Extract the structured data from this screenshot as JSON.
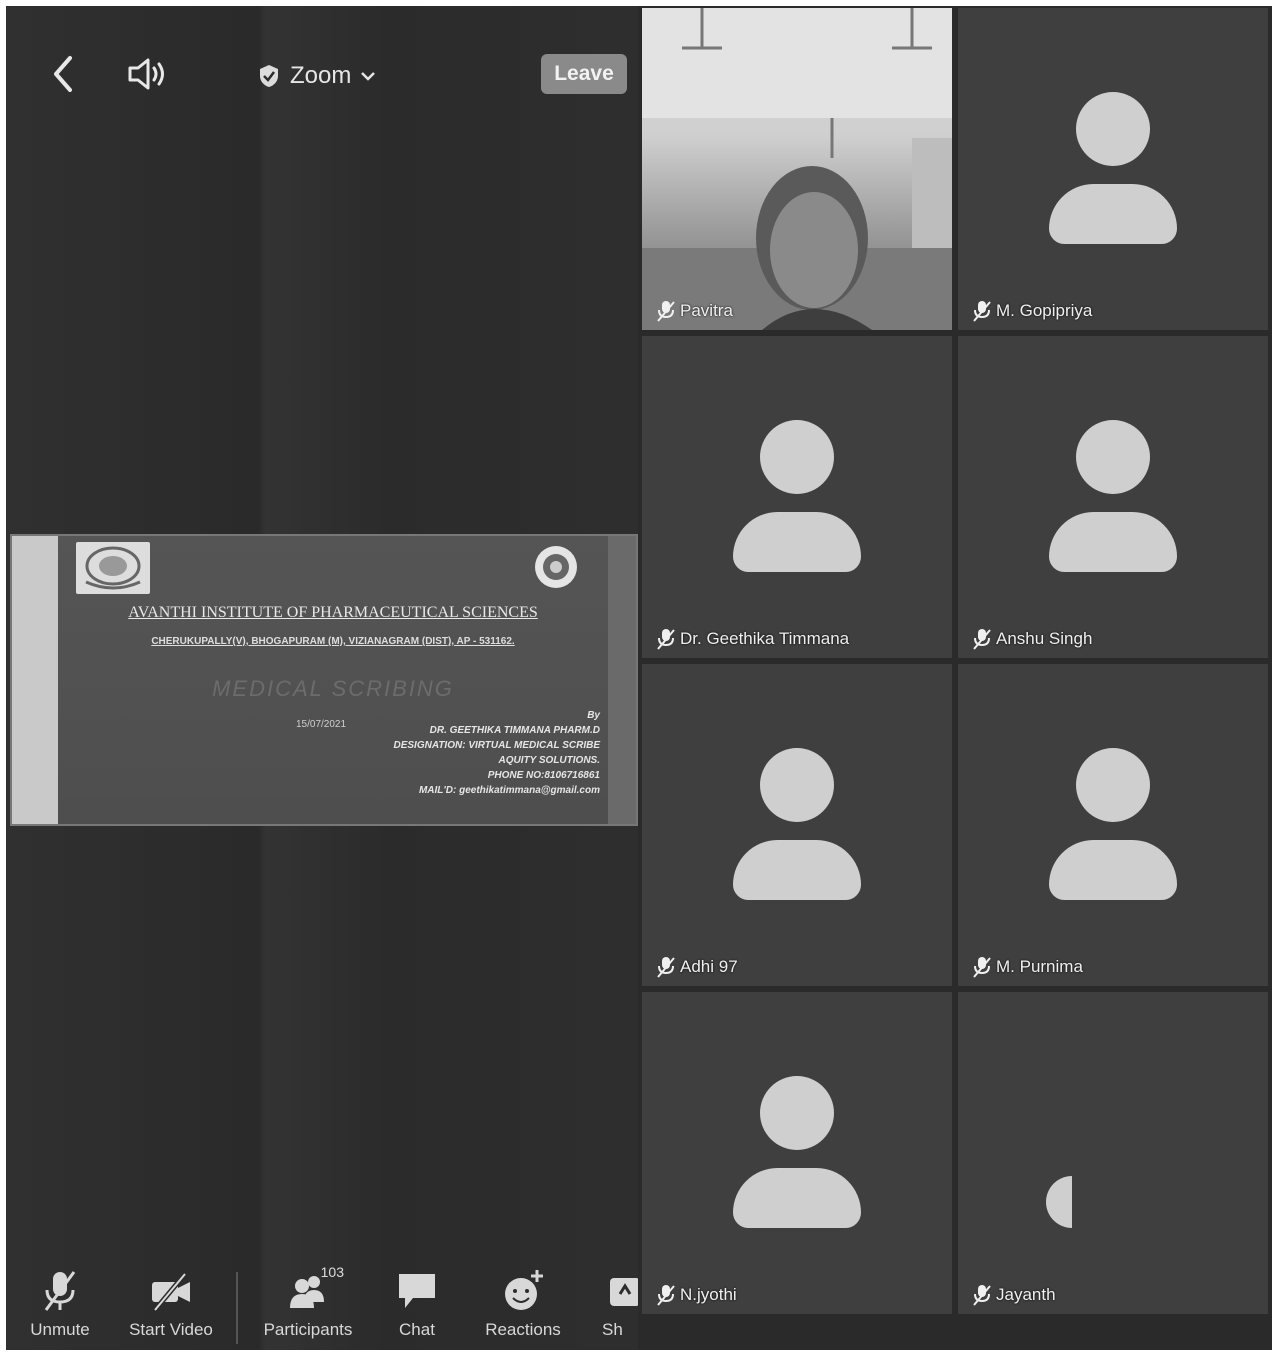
{
  "topbar": {
    "back_icon": "chevron-left-icon",
    "speaker_icon": "speaker-icon",
    "title": "Zoom",
    "leave_label": "Leave"
  },
  "share": {
    "institute": "AVANTHI INSTITUTE OF PHARMACEUTICAL SCIENCES",
    "address": "CHERUKUPALLY(V), BHOGAPURAM (M), VIZIANAGRAM (DIST), AP - 531162.",
    "topic": "MEDICAL SCRIBING",
    "date": "15/07/2021",
    "by_lines": [
      "By",
      "DR. GEETHIKA TIMMANA PHARM.D",
      "DESIGNATION: VIRTUAL MEDICAL SCRIBE",
      "AQUITY SOLUTIONS.",
      "PHONE NO:8106716861",
      "MAIL'D: geethikatimmana@gmail.com"
    ]
  },
  "toolbar": {
    "unmute": "Unmute",
    "start_video": "Start Video",
    "participants": "Participants",
    "participants_count": "103",
    "chat": "Chat",
    "reactions": "Reactions",
    "share": "Sh"
  },
  "participants": [
    {
      "name": "Pavitra"
    },
    {
      "name": "M. Gopipriya"
    },
    {
      "name": "Dr. Geethika Timmana"
    },
    {
      "name": "Anshu Singh"
    },
    {
      "name": "Adhi 97"
    },
    {
      "name": "M. Purnima"
    },
    {
      "name": "N.jyothi"
    },
    {
      "name": "Jayanth"
    }
  ],
  "colors": {
    "background": "#2c2c2c",
    "tile": "#3f3f3f",
    "avatar": "#cfcfcf",
    "leave_button": "#8a8a8a"
  }
}
